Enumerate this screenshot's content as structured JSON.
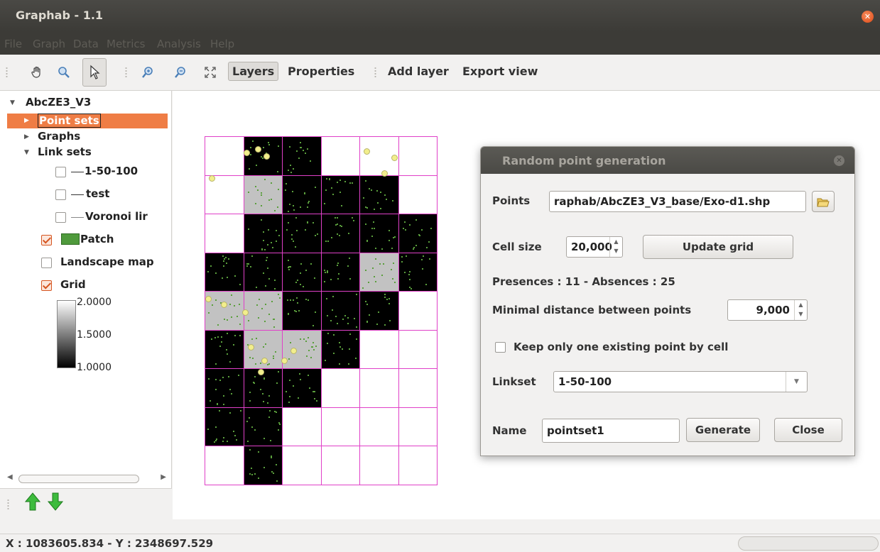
{
  "window": {
    "title": "Graphab - 1.1"
  },
  "menubar": {
    "items": [
      "File",
      "Graph",
      "Data",
      "Metrics",
      "Analysis",
      "Help"
    ]
  },
  "toolbar": {
    "tools": [
      "hand-icon",
      "zoom-region-icon",
      "select-arrow-icon",
      "zoom-in-icon",
      "zoom-out-icon",
      "fullextent-icon"
    ],
    "layers_label": "Layers",
    "properties_label": "Properties",
    "add_layer_label": "Add layer",
    "export_view_label": "Export view"
  },
  "sidebar": {
    "root": "AbcZE3_V3",
    "point_sets": "Point sets",
    "graphs": "Graphs",
    "link_sets": "Link sets",
    "linksets": [
      "1-50-100",
      "test",
      "Voronoi lir"
    ],
    "patch": "Patch",
    "landscape_map": "Landscape map",
    "grid": "Grid",
    "legend": [
      "2.0000",
      "1.5000",
      "1.0000"
    ],
    "patch_color": "#4f9a3c"
  },
  "map": {
    "grid_values": [
      [
        0,
        1,
        1,
        0,
        0,
        0
      ],
      [
        0,
        2,
        1,
        1,
        1,
        0
      ],
      [
        0,
        1,
        1,
        1,
        1,
        1
      ],
      [
        1,
        1,
        1,
        1,
        2,
        1
      ],
      [
        2,
        2,
        1,
        1,
        1,
        0
      ],
      [
        1,
        2,
        2,
        1,
        0,
        0
      ],
      [
        1,
        1,
        1,
        0,
        0,
        0
      ],
      [
        1,
        1,
        0,
        0,
        0,
        0
      ],
      [
        0,
        1,
        0,
        0,
        0,
        0
      ]
    ]
  },
  "dialog": {
    "title": "Random point generation",
    "points_label": "Points",
    "points_value": "raphab/AbcZE3_V3_base/Exo-d1.shp",
    "cell_size_label": "Cell size",
    "cell_size_value": "20,000",
    "update_grid_label": "Update grid",
    "presences_text": "Presences : 11 - Absences : 25",
    "min_distance_label": "Minimal distance between points",
    "min_distance_value": "9,000",
    "keep_one_label": "Keep only one existing point by cell",
    "linkset_label": "Linkset",
    "linkset_value": "1-50-100",
    "name_label": "Name",
    "name_value": "pointset1",
    "generate_label": "Generate",
    "close_label": "Close"
  },
  "statusbar": {
    "coords": "X : 1083605.834 - Y : 2348697.529"
  }
}
